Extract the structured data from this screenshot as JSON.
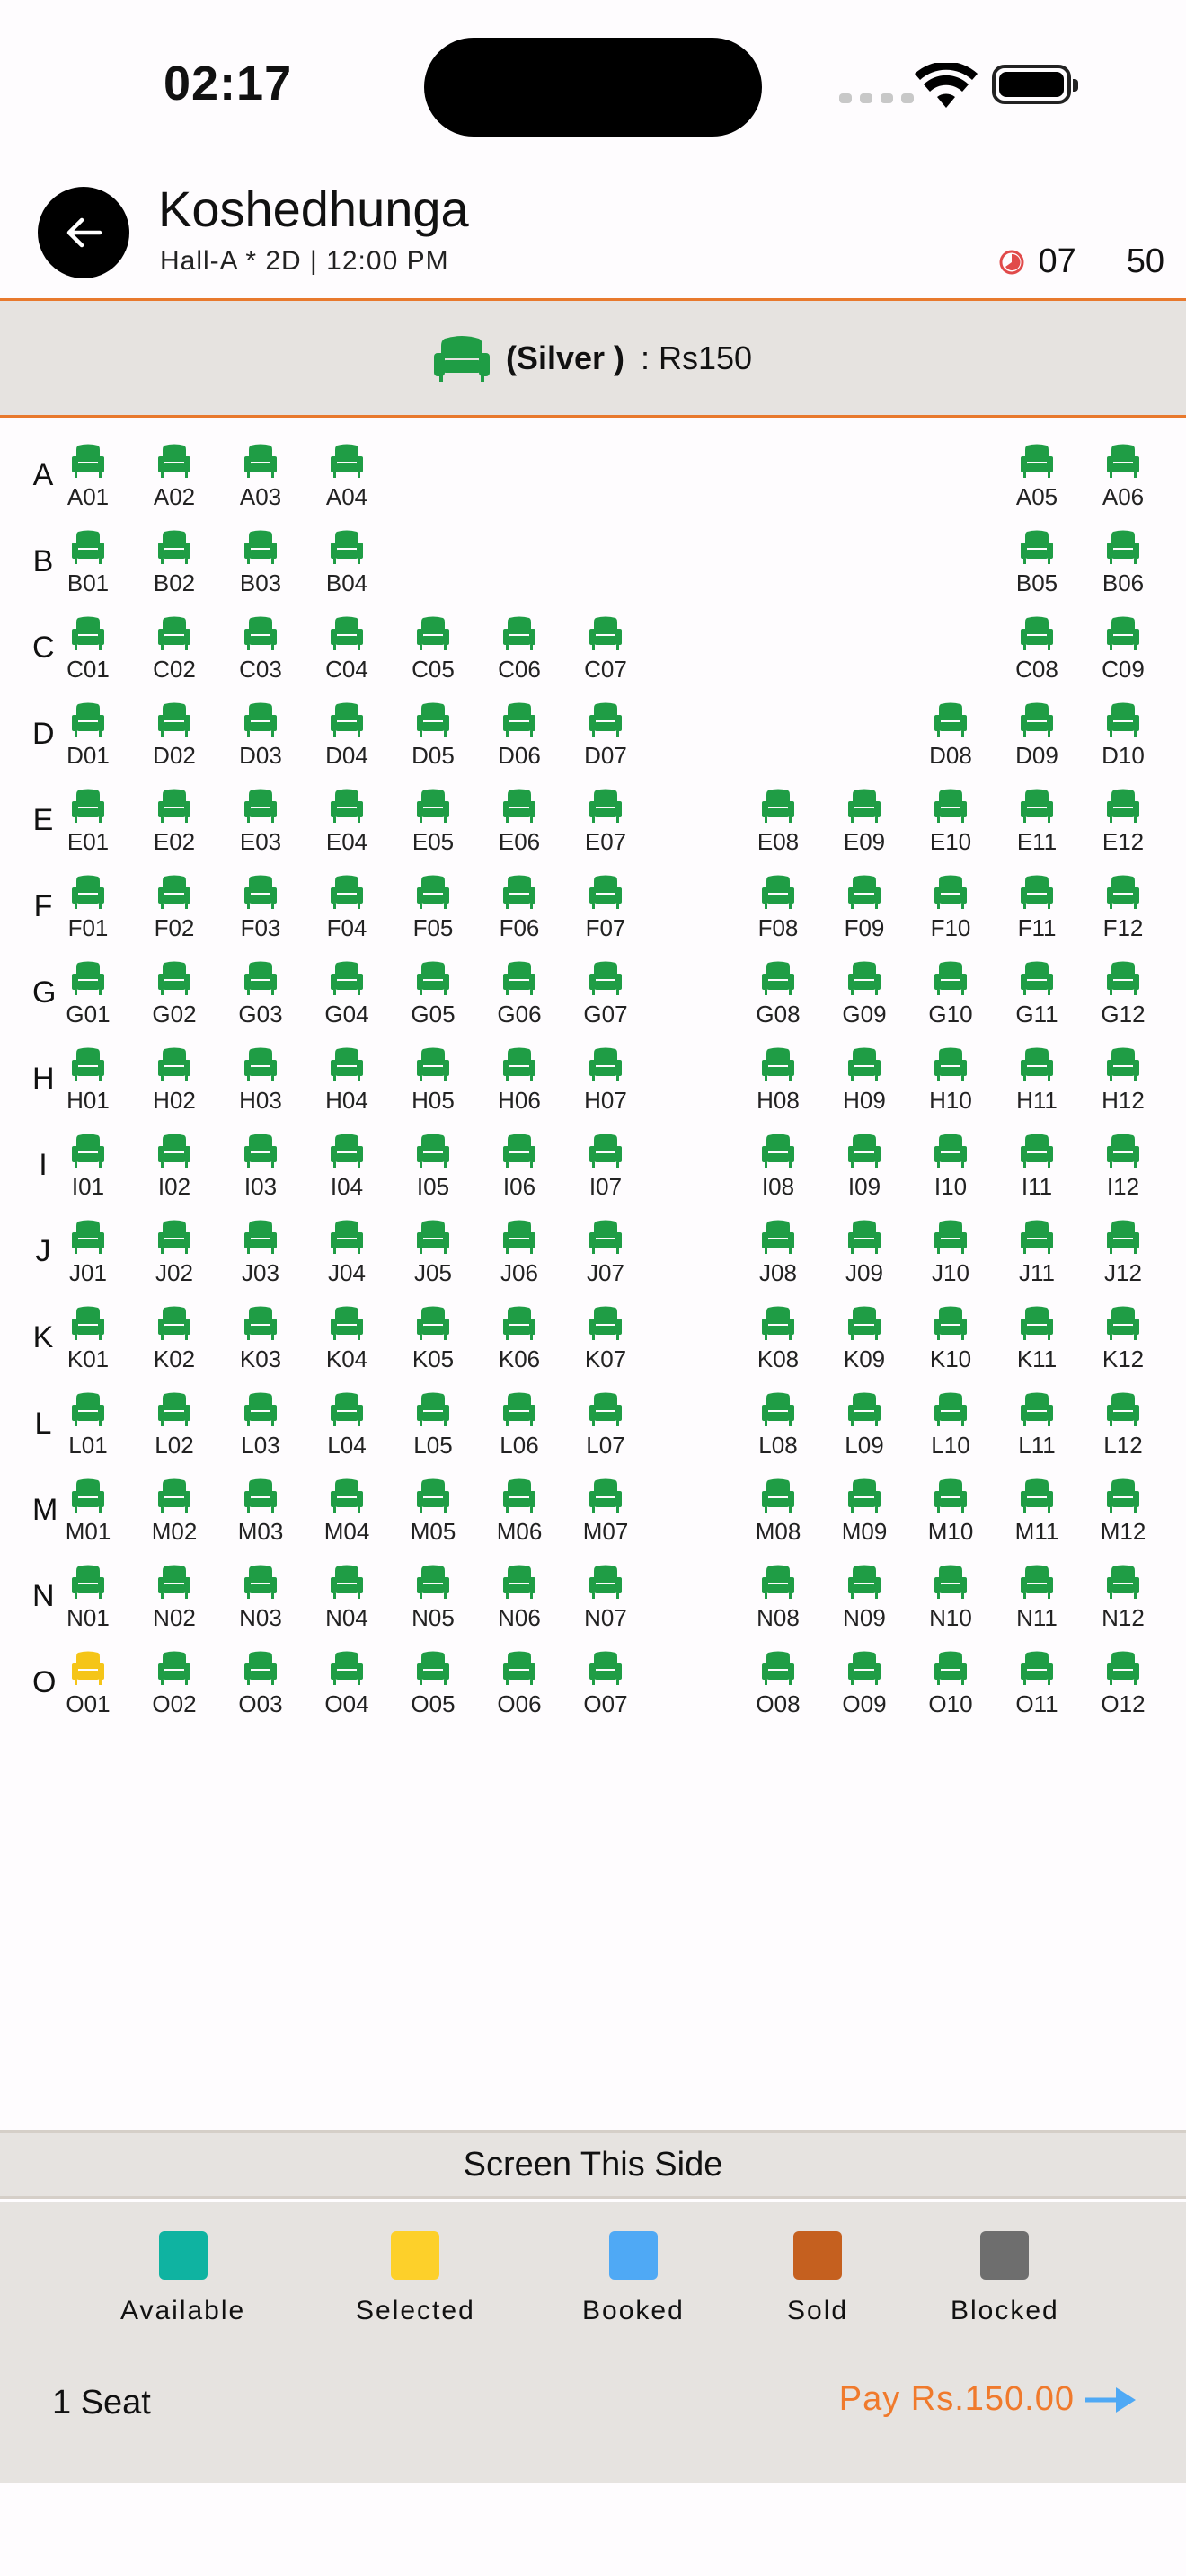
{
  "status_bar": {
    "time": "02:17"
  },
  "header": {
    "title": "Koshedhunga",
    "subtitle": "Hall-A * 2D | 12:00 PM",
    "timer_minutes": "07",
    "timer_seconds": "50"
  },
  "category": {
    "name": "(Silver )",
    "price": ": Rs150"
  },
  "seat_map": {
    "rows": [
      {
        "label": "A",
        "seats": [
          [
            1,
            "A01"
          ],
          [
            2,
            "A02"
          ],
          [
            3,
            "A03"
          ],
          [
            4,
            "A04"
          ],
          [
            12,
            "A05"
          ],
          [
            13,
            "A06"
          ]
        ]
      },
      {
        "label": "B",
        "seats": [
          [
            1,
            "B01"
          ],
          [
            2,
            "B02"
          ],
          [
            3,
            "B03"
          ],
          [
            4,
            "B04"
          ],
          [
            12,
            "B05"
          ],
          [
            13,
            "B06"
          ]
        ]
      },
      {
        "label": "C",
        "seats": [
          [
            1,
            "C01"
          ],
          [
            2,
            "C02"
          ],
          [
            3,
            "C03"
          ],
          [
            4,
            "C04"
          ],
          [
            5,
            "C05"
          ],
          [
            6,
            "C06"
          ],
          [
            7,
            "C07"
          ],
          [
            12,
            "C08"
          ],
          [
            13,
            "C09"
          ]
        ]
      },
      {
        "label": "D",
        "seats": [
          [
            1,
            "D01"
          ],
          [
            2,
            "D02"
          ],
          [
            3,
            "D03"
          ],
          [
            4,
            "D04"
          ],
          [
            5,
            "D05"
          ],
          [
            6,
            "D06"
          ],
          [
            7,
            "D07"
          ],
          [
            11,
            "D08"
          ],
          [
            12,
            "D09"
          ],
          [
            13,
            "D10"
          ]
        ]
      },
      {
        "label": "E",
        "seats": [
          [
            1,
            "E01"
          ],
          [
            2,
            "E02"
          ],
          [
            3,
            "E03"
          ],
          [
            4,
            "E04"
          ],
          [
            5,
            "E05"
          ],
          [
            6,
            "E06"
          ],
          [
            7,
            "E07"
          ],
          [
            9,
            "E08"
          ],
          [
            10,
            "E09"
          ],
          [
            11,
            "E10"
          ],
          [
            12,
            "E11"
          ],
          [
            13,
            "E12"
          ]
        ]
      },
      {
        "label": "F",
        "seats": [
          [
            1,
            "F01"
          ],
          [
            2,
            "F02"
          ],
          [
            3,
            "F03"
          ],
          [
            4,
            "F04"
          ],
          [
            5,
            "F05"
          ],
          [
            6,
            "F06"
          ],
          [
            7,
            "F07"
          ],
          [
            9,
            "F08"
          ],
          [
            10,
            "F09"
          ],
          [
            11,
            "F10"
          ],
          [
            12,
            "F11"
          ],
          [
            13,
            "F12"
          ]
        ]
      },
      {
        "label": "G",
        "seats": [
          [
            1,
            "G01"
          ],
          [
            2,
            "G02"
          ],
          [
            3,
            "G03"
          ],
          [
            4,
            "G04"
          ],
          [
            5,
            "G05"
          ],
          [
            6,
            "G06"
          ],
          [
            7,
            "G07"
          ],
          [
            9,
            "G08"
          ],
          [
            10,
            "G09"
          ],
          [
            11,
            "G10"
          ],
          [
            12,
            "G11"
          ],
          [
            13,
            "G12"
          ]
        ]
      },
      {
        "label": "H",
        "seats": [
          [
            1,
            "H01"
          ],
          [
            2,
            "H02"
          ],
          [
            3,
            "H03"
          ],
          [
            4,
            "H04"
          ],
          [
            5,
            "H05"
          ],
          [
            6,
            "H06"
          ],
          [
            7,
            "H07"
          ],
          [
            9,
            "H08"
          ],
          [
            10,
            "H09"
          ],
          [
            11,
            "H10"
          ],
          [
            12,
            "H11"
          ],
          [
            13,
            "H12"
          ]
        ]
      },
      {
        "label": "I",
        "seats": [
          [
            1,
            "I01"
          ],
          [
            2,
            "I02"
          ],
          [
            3,
            "I03"
          ],
          [
            4,
            "I04"
          ],
          [
            5,
            "I05"
          ],
          [
            6,
            "I06"
          ],
          [
            7,
            "I07"
          ],
          [
            9,
            "I08"
          ],
          [
            10,
            "I09"
          ],
          [
            11,
            "I10"
          ],
          [
            12,
            "I11"
          ],
          [
            13,
            "I12"
          ]
        ]
      },
      {
        "label": "J",
        "seats": [
          [
            1,
            "J01"
          ],
          [
            2,
            "J02"
          ],
          [
            3,
            "J03"
          ],
          [
            4,
            "J04"
          ],
          [
            5,
            "J05"
          ],
          [
            6,
            "J06"
          ],
          [
            7,
            "J07"
          ],
          [
            9,
            "J08"
          ],
          [
            10,
            "J09"
          ],
          [
            11,
            "J10"
          ],
          [
            12,
            "J11"
          ],
          [
            13,
            "J12"
          ]
        ]
      },
      {
        "label": "K",
        "seats": [
          [
            1,
            "K01"
          ],
          [
            2,
            "K02"
          ],
          [
            3,
            "K03"
          ],
          [
            4,
            "K04"
          ],
          [
            5,
            "K05"
          ],
          [
            6,
            "K06"
          ],
          [
            7,
            "K07"
          ],
          [
            9,
            "K08"
          ],
          [
            10,
            "K09"
          ],
          [
            11,
            "K10"
          ],
          [
            12,
            "K11"
          ],
          [
            13,
            "K12"
          ]
        ]
      },
      {
        "label": "L",
        "seats": [
          [
            1,
            "L01"
          ],
          [
            2,
            "L02"
          ],
          [
            3,
            "L03"
          ],
          [
            4,
            "L04"
          ],
          [
            5,
            "L05"
          ],
          [
            6,
            "L06"
          ],
          [
            7,
            "L07"
          ],
          [
            9,
            "L08"
          ],
          [
            10,
            "L09"
          ],
          [
            11,
            "L10"
          ],
          [
            12,
            "L11"
          ],
          [
            13,
            "L12"
          ]
        ]
      },
      {
        "label": "M",
        "seats": [
          [
            1,
            "M01"
          ],
          [
            2,
            "M02"
          ],
          [
            3,
            "M03"
          ],
          [
            4,
            "M04"
          ],
          [
            5,
            "M05"
          ],
          [
            6,
            "M06"
          ],
          [
            7,
            "M07"
          ],
          [
            9,
            "M08"
          ],
          [
            10,
            "M09"
          ],
          [
            11,
            "M10"
          ],
          [
            12,
            "M11"
          ],
          [
            13,
            "M12"
          ]
        ]
      },
      {
        "label": "N",
        "seats": [
          [
            1,
            "N01"
          ],
          [
            2,
            "N02"
          ],
          [
            3,
            "N03"
          ],
          [
            4,
            "N04"
          ],
          [
            5,
            "N05"
          ],
          [
            6,
            "N06"
          ],
          [
            7,
            "N07"
          ],
          [
            9,
            "N08"
          ],
          [
            10,
            "N09"
          ],
          [
            11,
            "N10"
          ],
          [
            12,
            "N11"
          ],
          [
            13,
            "N12"
          ]
        ]
      },
      {
        "label": "O",
        "seats": [
          [
            1,
            "O01"
          ],
          [
            2,
            "O02"
          ],
          [
            3,
            "O03"
          ],
          [
            4,
            "O04"
          ],
          [
            5,
            "O05"
          ],
          [
            6,
            "O06"
          ],
          [
            7,
            "O07"
          ],
          [
            9,
            "O08"
          ],
          [
            10,
            "O09"
          ],
          [
            11,
            "O10"
          ],
          [
            12,
            "O11"
          ],
          [
            13,
            "O12"
          ]
        ]
      }
    ],
    "selected_seats": [
      "O01"
    ],
    "seat_icon": "sofa-seat-icon",
    "available_seat_color": "#1f9d45",
    "selected_seat_color": "#f5c518"
  },
  "screen_label": "Screen This Side",
  "legend": [
    {
      "label": "Available",
      "color": "#0fb3a1"
    },
    {
      "label": "Selected",
      "color": "#fdd02a"
    },
    {
      "label": "Booked",
      "color": "#4fa9f5"
    },
    {
      "label": "Sold",
      "color": "#c5601f"
    },
    {
      "label": "Blocked",
      "color": "#6e6e6e"
    }
  ],
  "footer": {
    "seat_count": "1 Seat",
    "pay_label": "Pay Rs.150.00",
    "pay_color": "#f07a2c",
    "arrow_color": "#4fa9f5"
  }
}
